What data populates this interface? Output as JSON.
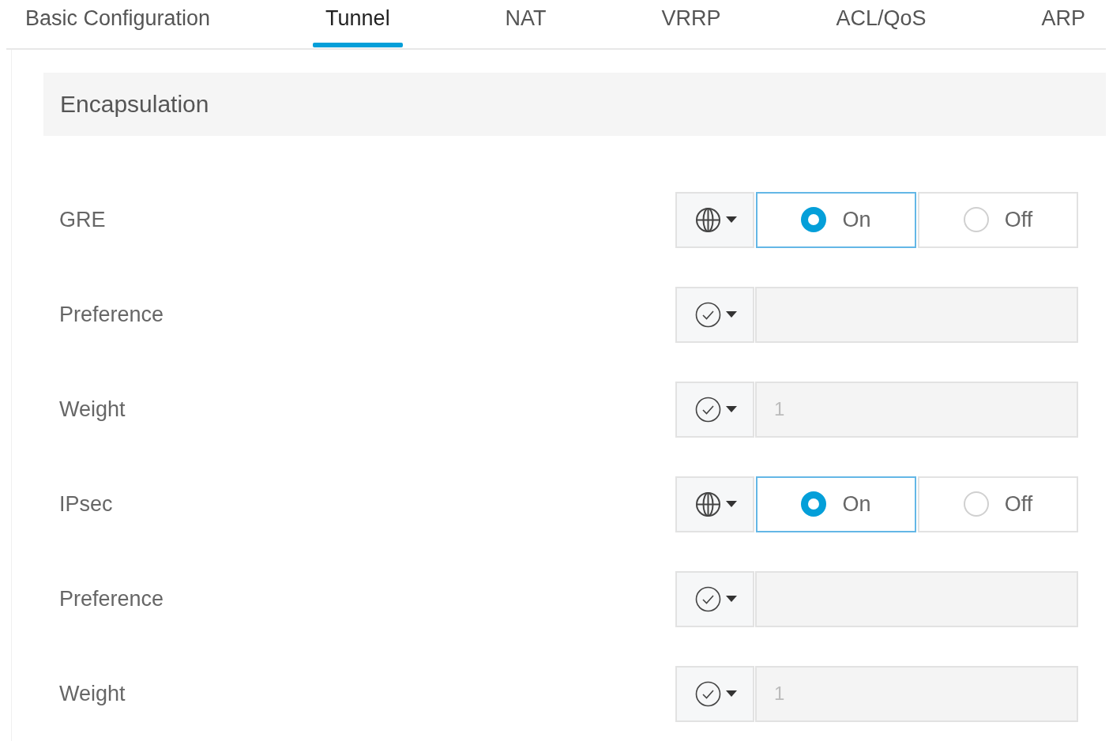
{
  "tabs": [
    {
      "label": "Basic Configuration",
      "selected": false
    },
    {
      "label": "Tunnel",
      "selected": true
    },
    {
      "label": "NAT",
      "selected": false
    },
    {
      "label": "VRRP",
      "selected": false
    },
    {
      "label": "ACL/QoS",
      "selected": false
    },
    {
      "label": "ARP",
      "selected": false
    }
  ],
  "section": {
    "title": "Encapsulation"
  },
  "rows": [
    {
      "label": "GRE",
      "scope": {
        "kind": "globe"
      },
      "kind": "radio",
      "options": [
        {
          "label": "On",
          "selected": true
        },
        {
          "label": "Off",
          "selected": false
        }
      ]
    },
    {
      "label": "Preference",
      "scope": {
        "kind": "check"
      },
      "kind": "input",
      "disabled": true
    },
    {
      "label": "Weight",
      "scope": {
        "kind": "check"
      },
      "kind": "input",
      "disabled": true,
      "value": "1"
    },
    {
      "label": "IPsec",
      "scope": {
        "kind": "globe"
      },
      "kind": "radio",
      "options": [
        {
          "label": "On",
          "selected": true
        },
        {
          "label": "Off",
          "selected": false
        }
      ]
    },
    {
      "label": "Preference",
      "scope": {
        "kind": "check"
      },
      "kind": "input",
      "disabled": true
    },
    {
      "label": "Weight",
      "scope": {
        "kind": "check"
      },
      "kind": "input",
      "disabled": true,
      "value": "1"
    }
  ]
}
